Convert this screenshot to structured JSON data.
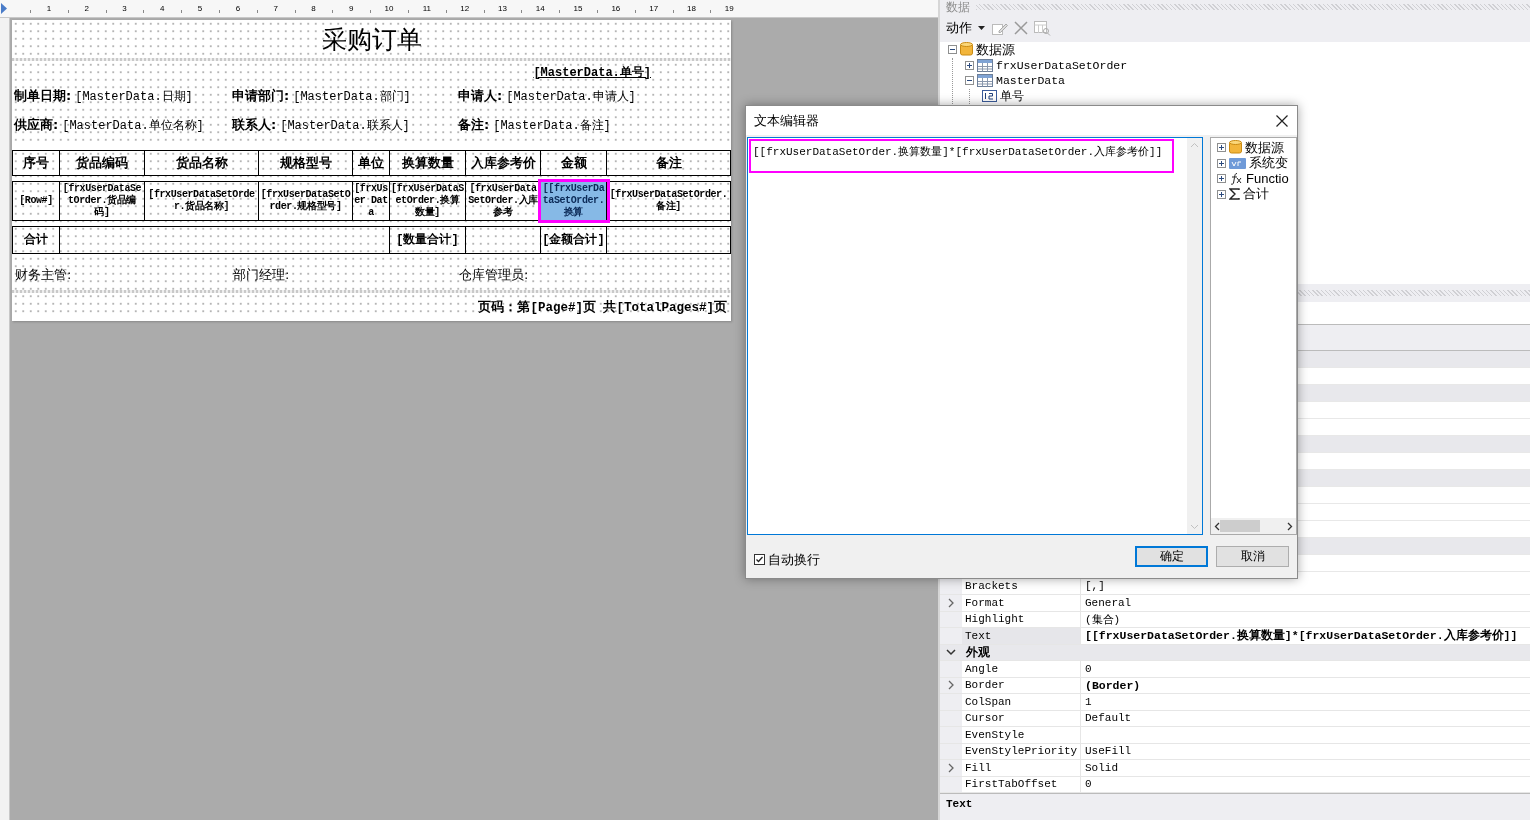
{
  "ruler": {
    "marks": [
      "1",
      "2",
      "3",
      "4",
      "5",
      "6",
      "7",
      "8",
      "9",
      "10",
      "11",
      "12",
      "13",
      "14",
      "15",
      "16",
      "17",
      "18",
      "19"
    ]
  },
  "report": {
    "title": "采购订单",
    "order_no": "[MasterData.单号]",
    "field_rows": [
      [
        {
          "label": "制单日期:",
          "value": "[MasterData.日期]"
        },
        {
          "label": "申请部门:",
          "value": "[MasterData.部门]"
        },
        {
          "label": "申请人:",
          "value": "[MasterData.申请人]"
        }
      ],
      [
        {
          "label": "供应商:",
          "value": "[MasterData.单位名称]"
        },
        {
          "label": "联系人:",
          "value": "[MasterData.联系人]"
        },
        {
          "label": "备注:",
          "value": "[MasterData.备注]"
        }
      ]
    ],
    "table": {
      "columns": [
        "序号",
        "货品编码",
        "货品名称",
        "规格型号",
        "单位",
        "换算数量",
        "入库参考价",
        "金额",
        "备注"
      ],
      "data_row": [
        {
          "text": "[Row#]",
          "selected": false
        },
        {
          "text": "[frxUserDataSetOrder.货品编码]",
          "selected": false
        },
        {
          "text": "[frxUserDataSetOrder.货品名称]",
          "selected": false
        },
        {
          "text": "[frxUserDataSetOrder.规格型号]",
          "selected": false
        },
        {
          "text": "[frxUser Data",
          "selected": false
        },
        {
          "text": "[frxUserDataSetOrder.换算数量]",
          "selected": false
        },
        {
          "text": "[frxUserDataSetOrder.入库参考",
          "selected": false
        },
        {
          "text": "[[frxUserDataSetOrder.换算",
          "selected": true
        },
        {
          "text": "[frxUserDataSetOrder.备注]",
          "selected": false
        }
      ],
      "total_row": {
        "label": "合计",
        "quantity_total": "[数量合计]",
        "amount_total": "[金额合计]"
      }
    },
    "signatures": [
      "财务主管:",
      "部门经理:",
      "仓库管理员:"
    ],
    "page_number": "页码：第[Page#]页 共[TotalPages#]页"
  },
  "data_panel": {
    "title": "数据",
    "actions_label": "动作",
    "tree": [
      {
        "label": "数据源",
        "kind": "database",
        "expanded": true,
        "children": [
          {
            "label": "frxUserDataSetOrder",
            "kind": "table",
            "expanded": false
          },
          {
            "label": "MasterData",
            "kind": "table",
            "expanded": true,
            "children": [
              {
                "label": "单号",
                "kind": "number"
              }
            ]
          }
        ]
      }
    ]
  },
  "properties": {
    "rows": [
      {
        "kind": "property",
        "name": "Brackets",
        "value": "[,]",
        "expandable": false,
        "bold": false,
        "selected": false
      },
      {
        "kind": "property",
        "name": "Format",
        "value": "General",
        "expandable": true,
        "bold": false,
        "selected": false
      },
      {
        "kind": "property",
        "name": "Highlight",
        "value": "(集合)",
        "expandable": false,
        "bold": false,
        "selected": false
      },
      {
        "kind": "property",
        "name": "Text",
        "value": "[[frxUserDataSetOrder.换算数量]*[frxUserDataSetOrder.入库参考价]]",
        "expandable": false,
        "bold": true,
        "selected": true
      },
      {
        "kind": "category",
        "name": "外观",
        "expanded": true
      },
      {
        "kind": "property",
        "name": "Angle",
        "value": "0",
        "expandable": false,
        "bold": false,
        "selected": false
      },
      {
        "kind": "property",
        "name": "Border",
        "value": "(Border)",
        "expandable": true,
        "bold": true,
        "selected": false
      },
      {
        "kind": "property",
        "name": "ColSpan",
        "value": "1",
        "expandable": false,
        "bold": false,
        "selected": false
      },
      {
        "kind": "property",
        "name": "Cursor",
        "value": "Default",
        "expandable": false,
        "bold": false,
        "selected": false
      },
      {
        "kind": "property",
        "name": "EvenStyle",
        "expandable": false,
        "selected": false
      },
      {
        "kind": "property",
        "name": "EvenStylePriority",
        "value": "UseFill",
        "expandable": false,
        "bold": false,
        "selected": false
      },
      {
        "kind": "property",
        "name": "Fill",
        "value": "Solid",
        "expandable": true,
        "bold": false,
        "selected": false
      },
      {
        "kind": "property",
        "name": "FirstTabOffset",
        "value": "0",
        "expandable": false,
        "bold": false,
        "selected": false
      }
    ],
    "description_title": "Text"
  },
  "dialog": {
    "title": "文本编辑器",
    "text": "[[frxUserDataSetOrder.换算数量]*[frxUserDataSetOrder.入库参考价]]",
    "tree": [
      {
        "label": "数据源",
        "kind": "database",
        "expanded": false
      },
      {
        "label": "系统变",
        "kind": "variable",
        "expanded": false
      },
      {
        "label": "Functio",
        "kind": "function",
        "expanded": false
      },
      {
        "label": "合计",
        "kind": "sum",
        "expanded": false
      }
    ],
    "word_wrap": {
      "label": "自动换行",
      "checked": true
    },
    "buttons": [
      {
        "label": "确定",
        "default": true
      },
      {
        "label": "取消",
        "default": false
      }
    ]
  }
}
